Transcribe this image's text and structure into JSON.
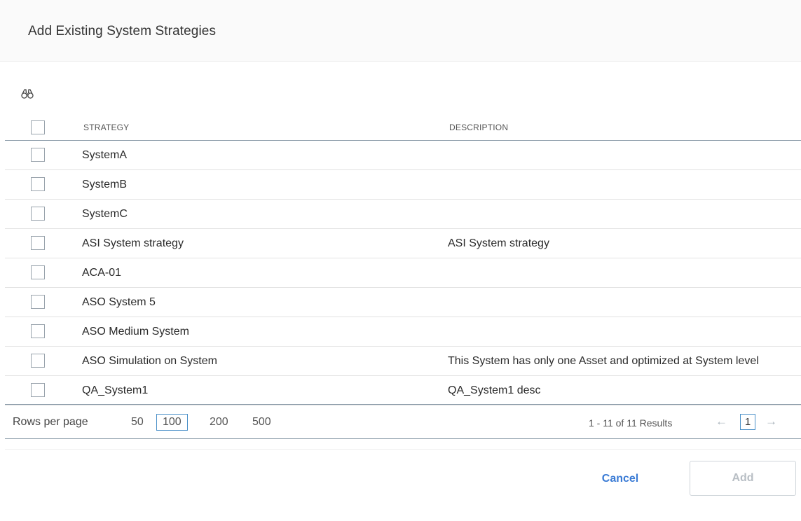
{
  "dialog": {
    "title": "Add Existing System Strategies"
  },
  "table": {
    "columns": {
      "strategy": "STRATEGY",
      "description": "DESCRIPTION"
    },
    "rows": [
      {
        "strategy": "SystemA",
        "description": ""
      },
      {
        "strategy": "SystemB",
        "description": ""
      },
      {
        "strategy": "SystemC",
        "description": ""
      },
      {
        "strategy": "ASI System strategy",
        "description": "ASI System strategy"
      },
      {
        "strategy": "ACA-01",
        "description": ""
      },
      {
        "strategy": "ASO System 5",
        "description": ""
      },
      {
        "strategy": "ASO Medium System",
        "description": ""
      },
      {
        "strategy": "ASO Simulation on System",
        "description": "This System has only one Asset and optimized at System level"
      },
      {
        "strategy": "QA_System1",
        "description": "QA_System1 desc"
      }
    ]
  },
  "pager": {
    "rows_per_page_label": "Rows per page",
    "options": [
      "50",
      "100",
      "200",
      "500"
    ],
    "selected": "100",
    "results": "1 - 11 of 11 Results",
    "page": "1",
    "prev": "←",
    "next": "→"
  },
  "footer": {
    "cancel_label": "Cancel",
    "add_label": "Add"
  },
  "colors": {
    "accent": "#3a7bd5",
    "selected_border": "#4a90c8",
    "disabled_text": "#b8bec4"
  }
}
